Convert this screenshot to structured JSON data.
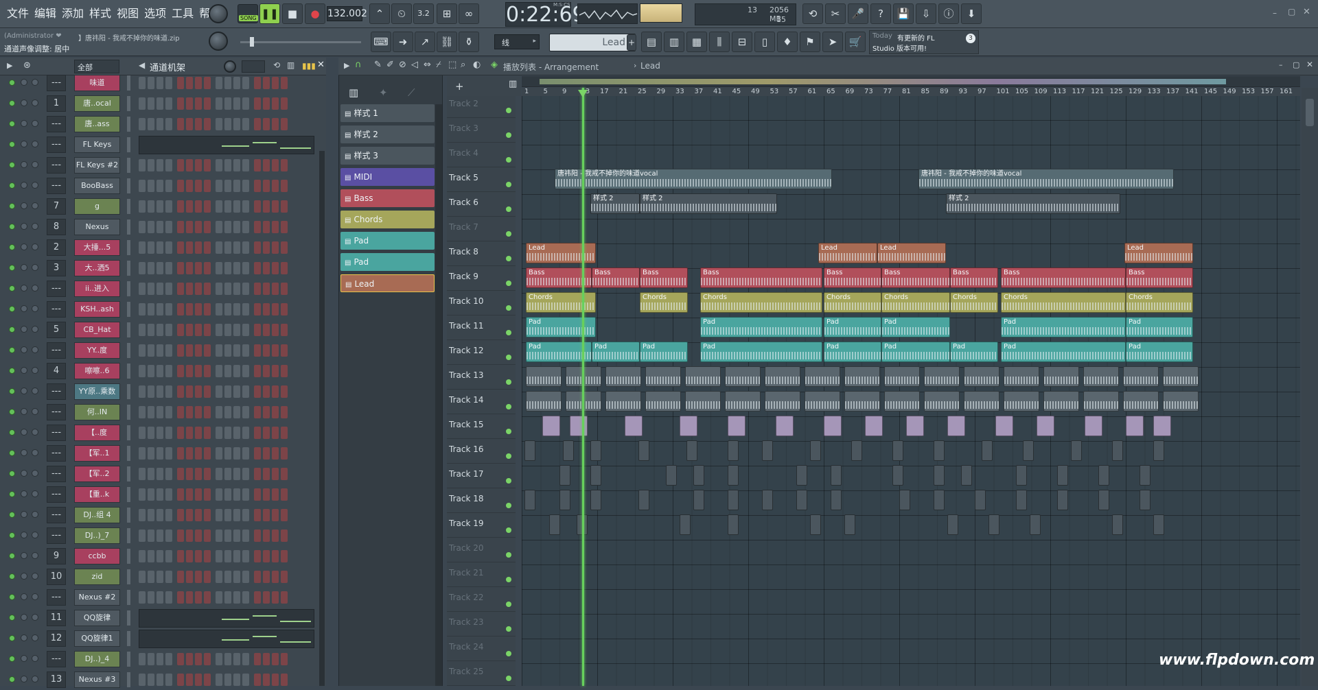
{
  "menu": [
    "文件",
    "编辑",
    "添加",
    "样式",
    "视图",
    "选项",
    "工具",
    "帮助"
  ],
  "transport": {
    "song_label": "SONG",
    "tempo": "132.002",
    "time": "0:22:69",
    "time_unit": "M:S:CS",
    "cpu_value": "13",
    "ram": "2056 MB",
    "poly": "15"
  },
  "hint": {
    "user": "(Administrator ❤",
    "file": "】唐祎阳 - 我戒不掉你的味道.zip",
    "status": "通道声像调整: 居中"
  },
  "snap": {
    "value": "线"
  },
  "pattern_select": {
    "value": "Lead"
  },
  "news": {
    "today": "Today",
    "line1": "有更新的 FL",
    "line2": "Studio 版本可用!",
    "badge": "3"
  },
  "rack": {
    "filter": "全部",
    "title": "通道机架",
    "channels": [
      {
        "num": "---",
        "name": "味道",
        "color": "pink"
      },
      {
        "num": "1",
        "name": "唐..ocal",
        "color": "green"
      },
      {
        "num": "---",
        "name": "唐..ass",
        "color": "green"
      },
      {
        "num": "---",
        "name": "FL Keys",
        "color": "dark",
        "roll": true
      },
      {
        "num": "---",
        "name": "FL Keys #2",
        "color": "dark"
      },
      {
        "num": "---",
        "name": "BooBass",
        "color": "dark"
      },
      {
        "num": "7",
        "name": "g",
        "color": "green"
      },
      {
        "num": "8",
        "name": "Nexus",
        "color": "dark"
      },
      {
        "num": "2",
        "name": "大捶...5",
        "color": "pink"
      },
      {
        "num": "3",
        "name": "大..洒5",
        "color": "pink"
      },
      {
        "num": "---",
        "name": "ii..进入",
        "color": "pink"
      },
      {
        "num": "---",
        "name": "KSH..ash",
        "color": "pink"
      },
      {
        "num": "5",
        "name": "CB_Hat",
        "color": "pink"
      },
      {
        "num": "---",
        "name": "YY..度",
        "color": "pink"
      },
      {
        "num": "4",
        "name": "嚓嚓..6",
        "color": "pink"
      },
      {
        "num": "---",
        "name": "YY原..乘数",
        "color": "teal"
      },
      {
        "num": "---",
        "name": "何..IN",
        "color": "green"
      },
      {
        "num": "---",
        "name": "【..度",
        "color": "pink"
      },
      {
        "num": "---",
        "name": "【军..1",
        "color": "pink"
      },
      {
        "num": "---",
        "name": "【军..2",
        "color": "pink"
      },
      {
        "num": "---",
        "name": "【重..k",
        "color": "pink"
      },
      {
        "num": "---",
        "name": "DJ..组 4",
        "color": "green"
      },
      {
        "num": "---",
        "name": "DJ..)_7",
        "color": "green"
      },
      {
        "num": "9",
        "name": "ccbb",
        "color": "pink"
      },
      {
        "num": "10",
        "name": "zid",
        "color": "green"
      },
      {
        "num": "---",
        "name": "Nexus #2",
        "color": "dark"
      },
      {
        "num": "11",
        "name": "QQ旋律",
        "color": "dark",
        "roll": true
      },
      {
        "num": "12",
        "name": "QQ旋律1",
        "color": "dark",
        "roll": true
      },
      {
        "num": "---",
        "name": "DJ..)_4",
        "color": "green"
      },
      {
        "num": "13",
        "name": "Nexus #3",
        "color": "dark"
      }
    ]
  },
  "patterns": [
    {
      "name": "样式 1",
      "color": "#4b565e"
    },
    {
      "name": "样式 2",
      "color": "#4b565e"
    },
    {
      "name": "样式 3",
      "color": "#4b565e"
    },
    {
      "name": "MIDI",
      "color": "#5a4fa3"
    },
    {
      "name": "Bass",
      "color": "#b14f5b"
    },
    {
      "name": "Chords",
      "color": "#a5a65b"
    },
    {
      "name": "Pad",
      "color": "#4aa59f"
    },
    {
      "name": "Pad",
      "color": "#4aa59f"
    },
    {
      "name": "Lead",
      "color": "#a86b54"
    }
  ],
  "playlist": {
    "title": "播放列表 - Arrangement",
    "crumb": "Lead",
    "ruler": [
      "1",
      "5",
      "9",
      "13",
      "17",
      "21",
      "25",
      "29",
      "33",
      "37",
      "41",
      "45",
      "49",
      "53",
      "57",
      "61",
      "65",
      "69",
      "73",
      "77",
      "81",
      "85",
      "89",
      "93",
      "97",
      "101",
      "105",
      "109",
      "113",
      "117",
      "121",
      "125",
      "129",
      "133",
      "137",
      "141",
      "145",
      "149",
      "153",
      "157",
      "161"
    ],
    "tracks": [
      "Track 2",
      "Track 3",
      "Track 4",
      "Track 5",
      "Track 6",
      "Track 7",
      "Track 8",
      "Track 9",
      "Track 10",
      "Track 11",
      "Track 12",
      "Track 13",
      "Track 14",
      "Track 15",
      "Track 16",
      "Track 17",
      "Track 18",
      "Track 19",
      "Track 20",
      "Track 21",
      "Track 22",
      "Track 23",
      "Track 24",
      "Track 25"
    ],
    "vocal_clip": "唐祎阳 - 我戒不掉你的味道vocal",
    "pattern2": "样式 2",
    "lead": "Lead",
    "bass": "Bass",
    "chords": "Chords",
    "pad": "Pad"
  },
  "watermark": "www.flpdown.com"
}
